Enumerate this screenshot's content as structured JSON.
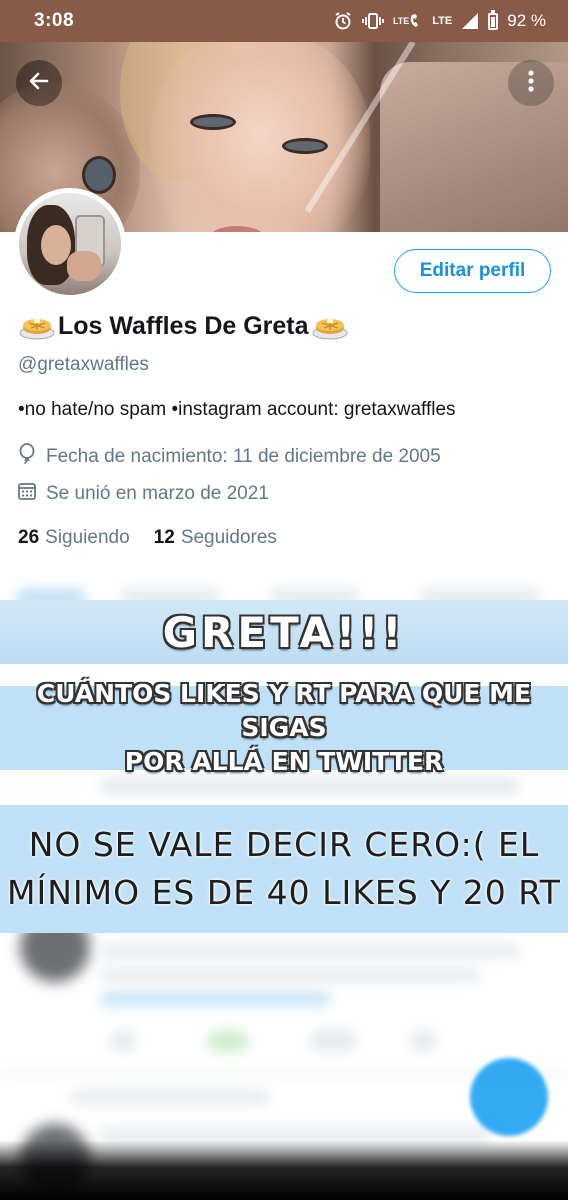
{
  "status_bar": {
    "time": "3:08",
    "battery_percent": "92 %",
    "lte_small": "LTE",
    "lte_label": "LTE"
  },
  "header": {
    "back_icon": "arrow-left-icon",
    "more_icon": "more-vertical-icon"
  },
  "profile": {
    "edit_button": "Editar perfil",
    "display_name": "Los Waffles De Greta",
    "handle": "@gretaxwaffles",
    "bio": "•no hate/no spam •instagram account: gretaxwaffles",
    "birth": "Fecha de nacimiento: 11 de diciembre de 2005",
    "joined": "Se unió en marzo de 2021",
    "following_count": "26",
    "following_label": "Siguiendo",
    "followers_count": "12",
    "followers_label": "Seguidores"
  },
  "overlay": {
    "title": "GRETA!!!",
    "question_line1": "CUÁNTOS LIKES Y RT PARA QUE ME SIGAS",
    "question_line2": "POR ALLÁ EN TWITTER",
    "rule_line1": "NO SE VALE DECIR CERO:( EL",
    "rule_line2": "MÍNIMO ES DE 40 LIKES Y 20 RT"
  },
  "colors": {
    "accent": "#1da1f2",
    "overlay_bg": "#bfe0f6",
    "status_bar": "#8a5a48"
  }
}
